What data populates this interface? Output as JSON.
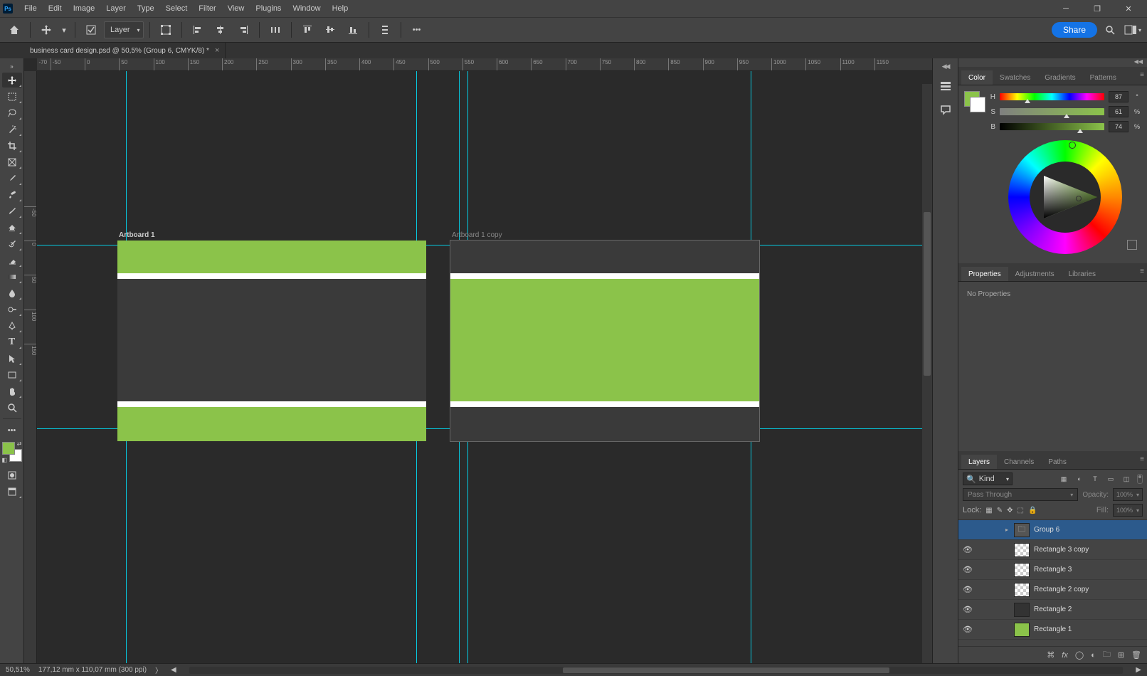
{
  "menu": [
    "File",
    "Edit",
    "Image",
    "Layer",
    "Type",
    "Select",
    "Filter",
    "View",
    "Plugins",
    "Window",
    "Help"
  ],
  "optionsbar": {
    "dropdown_label": "Layer",
    "share_label": "Share"
  },
  "doctab": {
    "title": "business card design.psd @ 50,5% (Group 6, CMYK/8) *"
  },
  "ruler_h": [
    -70,
    -50,
    0,
    50,
    100,
    150,
    200,
    250,
    300,
    350,
    400,
    450,
    500,
    550,
    600,
    650,
    700,
    750,
    800,
    850,
    900,
    950,
    1000,
    1050,
    1100,
    1150
  ],
  "ruler_v": [
    -50,
    0,
    50,
    100,
    150
  ],
  "artboards": {
    "a1_label": "Artboard 1",
    "a2_label": "Artboard 1 copy"
  },
  "color_tabs": [
    "Color",
    "Swatches",
    "Gradients",
    "Patterns"
  ],
  "color_tabs_active": 0,
  "color": {
    "h": {
      "lbl": "H",
      "val": "87",
      "unit": "°",
      "pos": 24
    },
    "s": {
      "lbl": "S",
      "val": "61",
      "unit": "%",
      "pos": 61
    },
    "b": {
      "lbl": "B",
      "val": "74",
      "unit": "%",
      "pos": 74
    }
  },
  "props_tabs": [
    "Properties",
    "Adjustments",
    "Libraries"
  ],
  "props_tabs_active": 0,
  "props_msg": "No Properties",
  "layers_tabs": [
    "Layers",
    "Channels",
    "Paths"
  ],
  "layers_tabs_active": 0,
  "layers_controls": {
    "search_kind_label": "Kind",
    "blend_mode": "Pass Through",
    "opacity_label": "Opacity:",
    "opacity_value": "100%",
    "lock_label": "Lock:",
    "fill_label": "Fill:",
    "fill_value": "100%"
  },
  "layers": [
    {
      "name": "Group 6",
      "type": "group",
      "selected": true,
      "indent": 40,
      "vis": false
    },
    {
      "name": "Rectangle 3 copy",
      "type": "shape",
      "thumb": "checker",
      "indent": 52,
      "vis": true
    },
    {
      "name": "Rectangle 3",
      "type": "shape",
      "thumb": "checker",
      "indent": 52,
      "vis": true
    },
    {
      "name": "Rectangle 2 copy",
      "type": "shape",
      "thumb": "checker",
      "indent": 52,
      "vis": true
    },
    {
      "name": "Rectangle 2",
      "type": "shape",
      "thumb": "dark",
      "indent": 52,
      "vis": true
    },
    {
      "name": "Rectangle 1",
      "type": "shape",
      "thumb": "green",
      "indent": 52,
      "vis": true
    }
  ],
  "status": {
    "zoom": "50,51%",
    "doc_info": "177,12 mm x 110,07 mm (300 ppi)"
  }
}
